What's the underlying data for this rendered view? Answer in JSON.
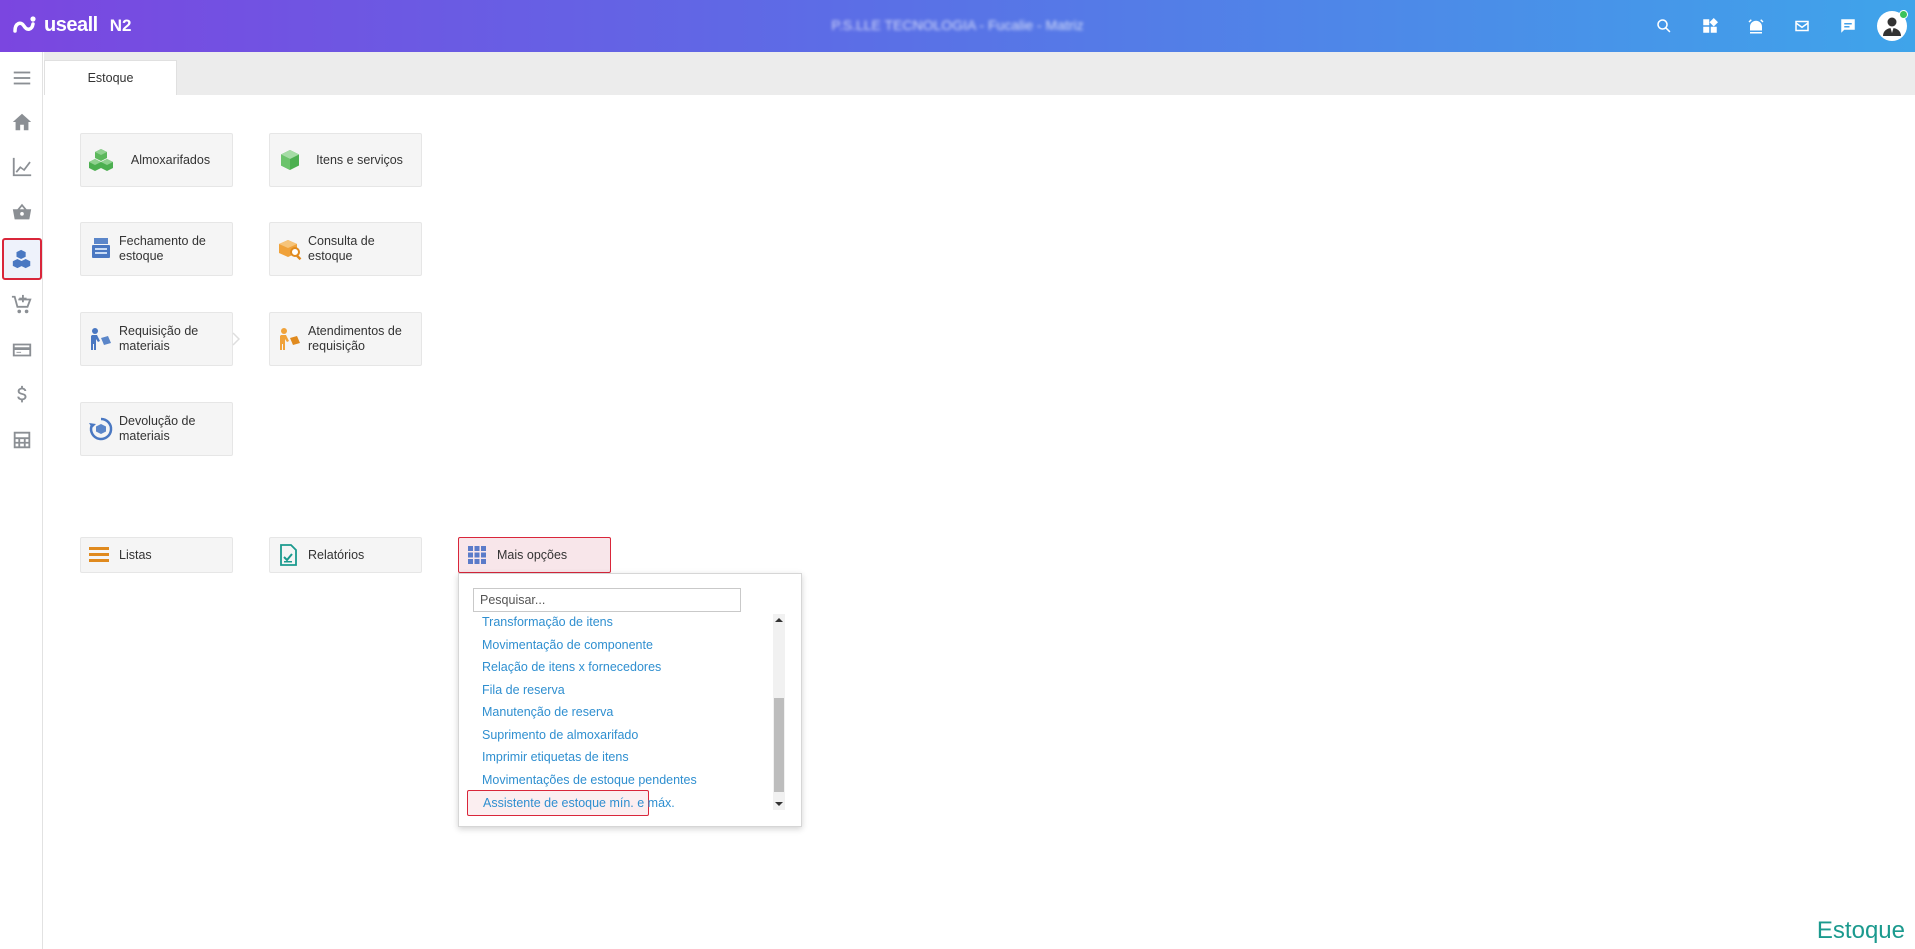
{
  "app": {
    "logo_text": "useall",
    "version": "N2",
    "company": "P.S.LLE TECNOLOGIA - Fucalie - Matriz"
  },
  "topbar": {
    "icons": [
      "search-icon",
      "apps-grid-icon",
      "alarm-icon",
      "mail-icon",
      "chat-icon",
      "user-avatar"
    ]
  },
  "sidebar": {
    "items": [
      {
        "name": "menu-icon"
      },
      {
        "name": "home-icon"
      },
      {
        "name": "chart-line-icon"
      },
      {
        "name": "basket-icon"
      },
      {
        "name": "boxes-icon",
        "active": true
      },
      {
        "name": "cart-add-icon"
      },
      {
        "name": "credit-card-icon"
      },
      {
        "name": "dollar-icon"
      },
      {
        "name": "calculator-icon"
      }
    ]
  },
  "tabs": [
    {
      "label": "Estoque"
    }
  ],
  "tiles": {
    "almoxarifados": "Almoxarifados",
    "itens_servicos": "Itens e serviços",
    "fechamento": "Fechamento de estoque",
    "consulta": "Consulta de estoque",
    "requisicao": "Requisição de materiais",
    "atendimentos": "Atendimentos de requisição",
    "devolucao": "Devolução de materiais"
  },
  "actions": {
    "listas": "Listas",
    "relatorios": "Relatórios",
    "mais_opcoes": "Mais opções"
  },
  "dropdown": {
    "search_placeholder": "Pesquisar...",
    "options": [
      "Transformação de itens",
      "Movimentação de componente",
      "Relação de itens x fornecedores",
      "Fila de reserva",
      "Manutenção de reserva",
      "Suprimento de almoxarifado",
      "Imprimir etiquetas de itens",
      "Movimentações de estoque pendentes",
      "Assistente de estoque mín. e máx."
    ],
    "selected_index": 8
  },
  "module_label": "Estoque",
  "colors": {
    "accent_red": "#d9263a",
    "link_blue": "#2f8fd0",
    "module_teal": "#1b9a8e"
  }
}
